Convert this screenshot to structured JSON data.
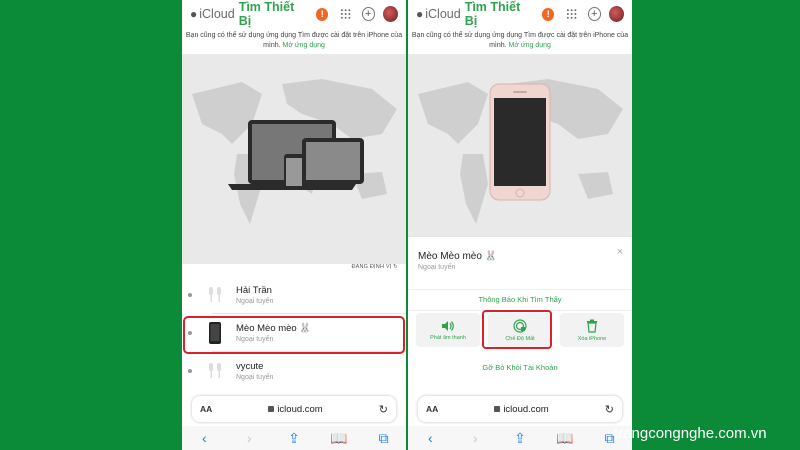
{
  "header": {
    "brand": "iCloud",
    "app_title": "Tìm Thiết Bị",
    "alert": "!",
    "plus": "+"
  },
  "banner": {
    "text": "Bạn cũng có thể sử dụng ứng dụng Tìm được cài đặt trên iPhone của mình.",
    "link": "Mở ứng dụng"
  },
  "left": {
    "locate_label": "ĐANG ĐỊNH VỊ",
    "devices": [
      {
        "name": "Hải Trần",
        "status": "Ngoại tuyến",
        "icon": "airpods-icon"
      },
      {
        "name": "Mèo Mèo mèo 🐰",
        "status": "Ngoại tuyến",
        "icon": "iphone-icon"
      },
      {
        "name": "vycute",
        "status": "Ngoại tuyến",
        "icon": "airpods-icon"
      }
    ]
  },
  "right": {
    "device_name": "Mèo Mèo mèo 🐰",
    "device_status": "Ngoại tuyến",
    "close": "×",
    "notify": "Thông Báo Khi Tìm Thấy",
    "actions": [
      {
        "label": "Phát âm thanh",
        "icon": "speaker-icon"
      },
      {
        "label": "Chế Độ Mất",
        "icon": "lost-mode-icon"
      },
      {
        "label": "Xóa iPhone",
        "icon": "trash-icon"
      }
    ],
    "remove": "Gỡ Bỏ Khỏi Tài Khoản"
  },
  "browser": {
    "aa": "AA",
    "url": "icloud.com",
    "reload": "↻",
    "toolbar": [
      "‹",
      "›",
      "⇪",
      "📖",
      "⧉"
    ]
  },
  "watermark": "trangcongnghe.com.vn",
  "colors": {
    "background": "#0b8a38",
    "accent": "#2ea44f",
    "alert": "#f26522",
    "highlight": "#d8232a",
    "link_blue": "#1a7cf5"
  }
}
